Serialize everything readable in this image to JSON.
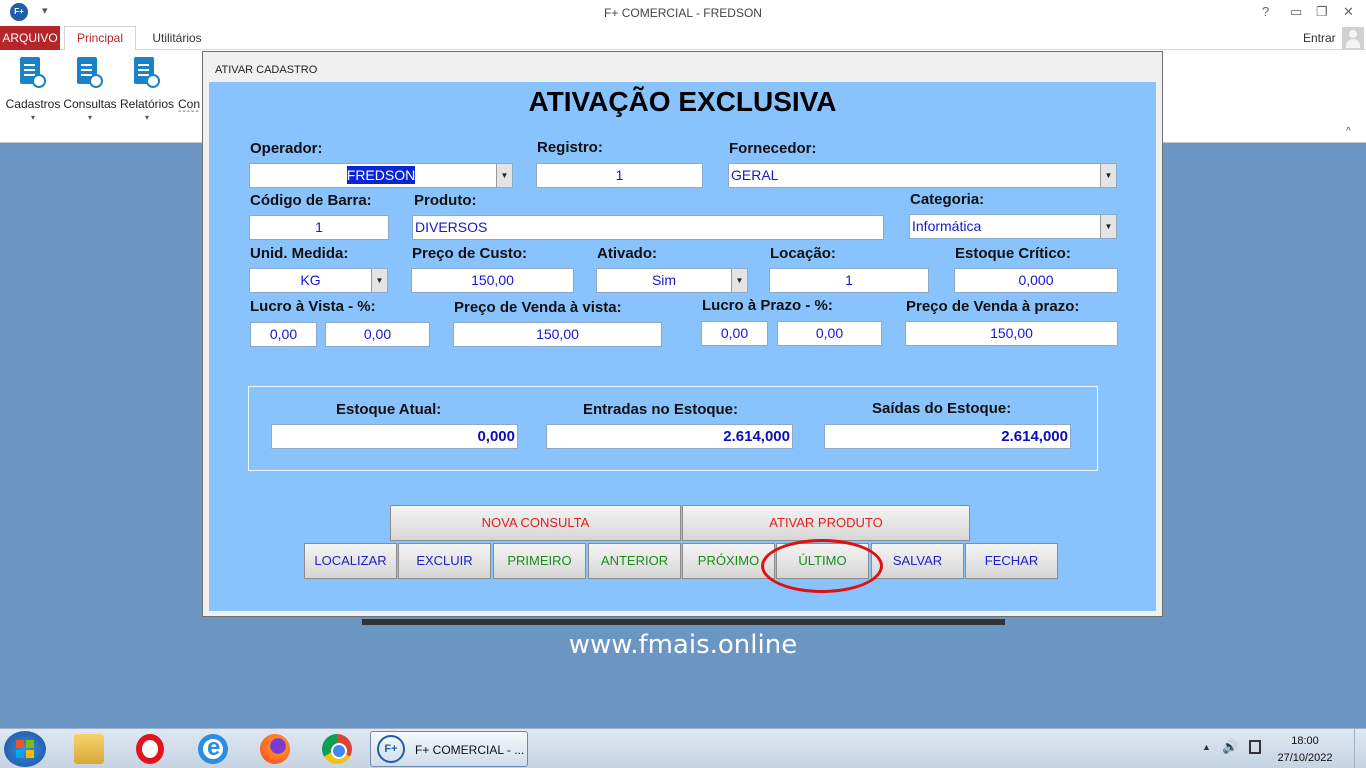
{
  "window": {
    "title": "F+ COMERCIAL - FREDSON",
    "logo_text": "F+",
    "qa_arrow": "▾",
    "help": "?",
    "restore_ribbon": "▭",
    "minimize": "—",
    "maximize": "❐",
    "close": "✕"
  },
  "ribbon": {
    "tabs": {
      "arquivo": "ARQUIVO",
      "principal": "Principal",
      "utilitarios": "Utilitários"
    },
    "entrar": "Entrar",
    "buttons": {
      "cadastros": "Cadastros",
      "consultas": "Consultas",
      "relatorios": "Relatórios",
      "con": "Con"
    },
    "dropdown_arrow": "▾",
    "con_dash": "-----",
    "collapse": "^"
  },
  "dialog": {
    "title": "ATIVAR CADASTRO",
    "heading": "ATIVAÇÃO EXCLUSIVA",
    "labels": {
      "operador": "Operador:",
      "registro": "Registro:",
      "fornecedor": "Fornecedor:",
      "codigo_barra": "Código de Barra:",
      "produto": "Produto:",
      "categoria": "Categoria:",
      "unid_medida": "Unid. Medida:",
      "preco_custo": "Preço de Custo:",
      "ativado": "Ativado:",
      "locacao": "Locação:",
      "estoque_critico": "Estoque Crítico:",
      "lucro_vista": "Lucro à Vista - %:",
      "preco_venda_vista": "Preço de Venda à vista:",
      "lucro_prazo": "Lucro à Prazo - %:",
      "preco_venda_prazo": "Preço de Venda à prazo:",
      "estoque_atual": "Estoque Atual:",
      "entradas_estoque": "Entradas no Estoque:",
      "saidas_estoque": "Saídas do Estoque:"
    },
    "values": {
      "operador": "FREDSON",
      "registro": "1",
      "fornecedor": "GERAL",
      "codigo_barra": "1",
      "produto": "DIVERSOS",
      "categoria": "Informática",
      "unid_medida": "KG",
      "preco_custo": "150,00",
      "ativado": "Sim",
      "locacao": "1",
      "estoque_critico": "0,000",
      "lucro_vista_pct": "0,00",
      "lucro_vista_valor": "0,00",
      "preco_venda_vista": "150,00",
      "lucro_prazo_pct": "0,00",
      "lucro_prazo_valor": "0,00",
      "preco_venda_prazo": "150,00",
      "estoque_atual": "0,000",
      "entradas_estoque": "2.614,000",
      "saidas_estoque": "2.614,000"
    },
    "dropdown_arrow": "▼",
    "buttons": {
      "nova_consulta": "NOVA CONSULTA",
      "ativar_produto": "ATIVAR PRODUTO",
      "localizar": "LOCALIZAR",
      "excluir": "EXCLUIR",
      "primeiro": "PRIMEIRO",
      "anterior": "ANTERIOR",
      "proximo": "PRÓXIMO",
      "ultimo": "ÚLTIMO",
      "salvar": "SALVAR",
      "fechar": "FECHAR"
    }
  },
  "watermark": "www.fmais.online",
  "taskbar": {
    "active_app_icon": "F+",
    "active_app_label": "F+ COMERCIAL - ...",
    "tray_arrow": "▲",
    "volume": "🔊",
    "time": "18:00",
    "date": "27/10/2022"
  },
  "colors": {
    "accent": "#b6252a",
    "dialog_bg": "#89c3fd",
    "desktop": "#6b96c3",
    "highlight": "#e01010"
  },
  "icons": [
    "cadastros-icon",
    "consultas-icon",
    "relatorios-icon",
    "user-avatar-icon",
    "windows-start-icon",
    "explorer-icon",
    "opera-icon",
    "ie-icon",
    "firefox-icon",
    "chrome-icon"
  ]
}
